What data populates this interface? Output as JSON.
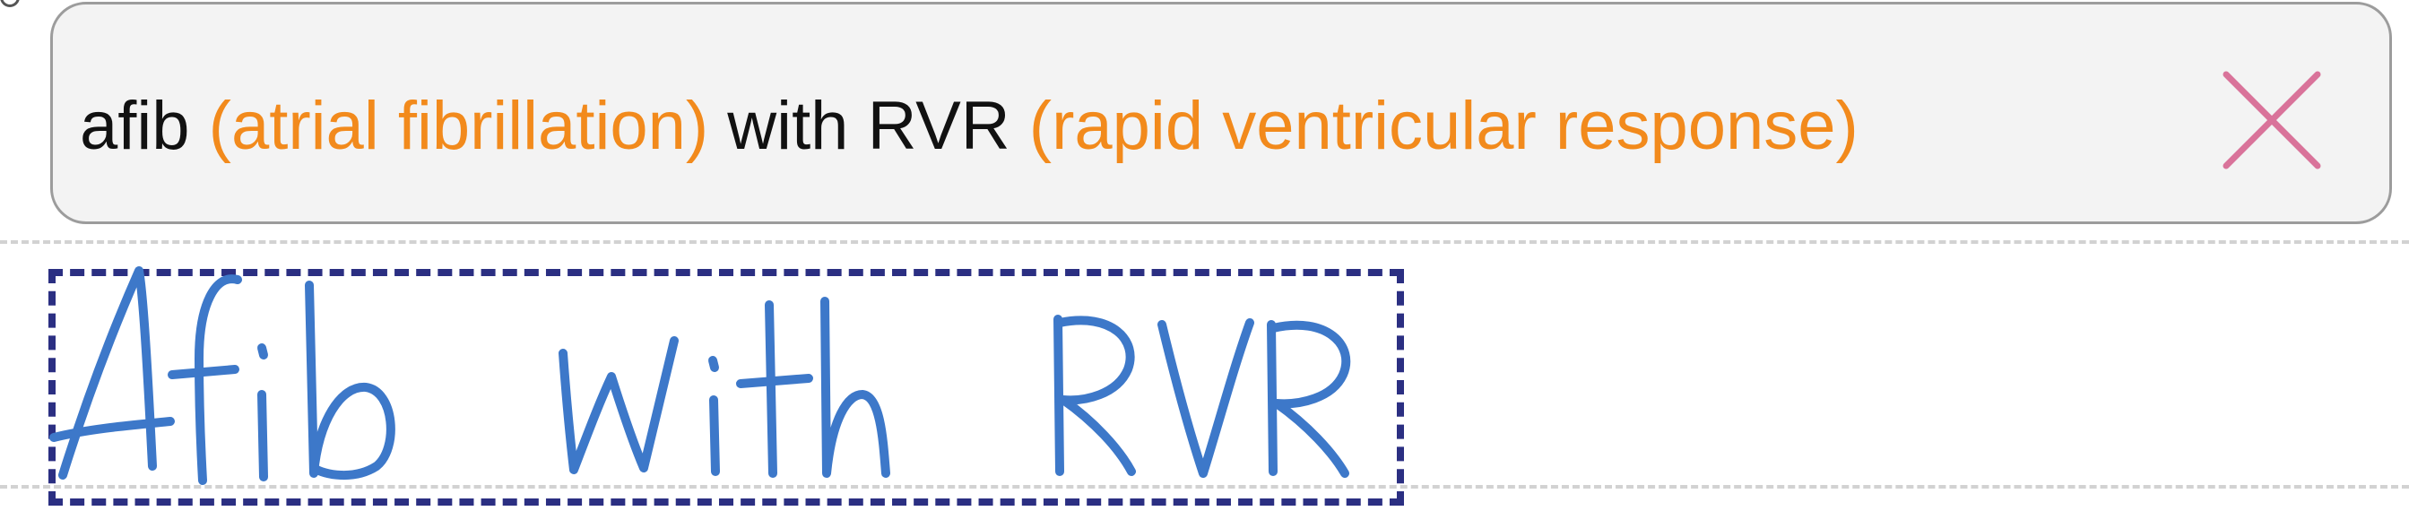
{
  "suggestion": {
    "term_1": "afib",
    "expansion_1": "(atrial fibrillation)",
    "term_2": "with RVR",
    "expansion_2": "(rapid ventricular response)",
    "close_icon": "close-icon",
    "colors": {
      "term": "#111111",
      "expansion": "#f28a1c",
      "close": "#d9739a",
      "pill_background": "#f3f3f3",
      "pill_border": "#9c9c9c"
    }
  },
  "ink": {
    "handwritten_text": "Afib with RVR",
    "ink_color": "#3d78c9",
    "selection_color": "#2b2f82"
  }
}
